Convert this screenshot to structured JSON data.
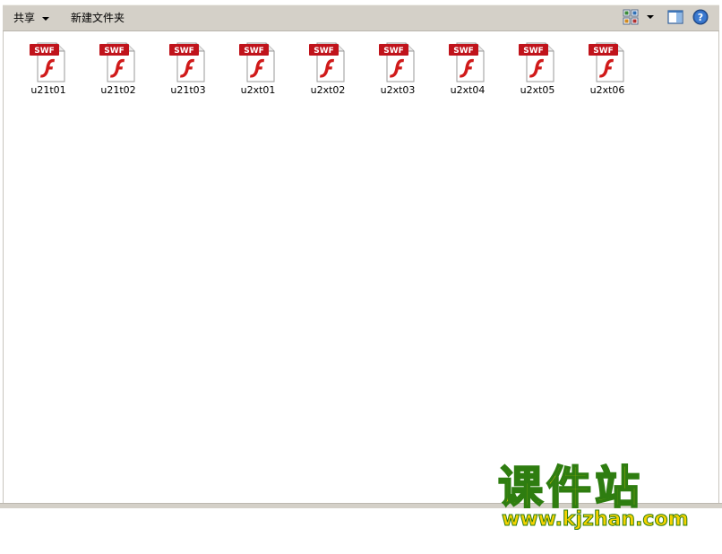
{
  "toolbar": {
    "share_label": "共享",
    "new_folder_label": "新建文件夹",
    "icons": [
      "views-icon",
      "chevron-down-icon",
      "preview-pane-icon",
      "help-icon"
    ]
  },
  "files": [
    {
      "name": "u21t01",
      "type_badge": "SWF"
    },
    {
      "name": "u21t02",
      "type_badge": "SWF"
    },
    {
      "name": "u21t03",
      "type_badge": "SWF"
    },
    {
      "name": "u2xt01",
      "type_badge": "SWF"
    },
    {
      "name": "u2xt02",
      "type_badge": "SWF"
    },
    {
      "name": "u2xt03",
      "type_badge": "SWF"
    },
    {
      "name": "u2xt04",
      "type_badge": "SWF"
    },
    {
      "name": "u2xt05",
      "type_badge": "SWF"
    },
    {
      "name": "u2xt06",
      "type_badge": "SWF"
    }
  ],
  "watermark": {
    "title": "课件站",
    "url": "www.kjzhan.com"
  },
  "colors": {
    "toolbar_bg": "#d4d0c8",
    "swf_badge": "#c0131b",
    "flash_f": "#d01a1a",
    "watermark_yellow": "#ffd800",
    "watermark_green": "#2e7d10"
  }
}
